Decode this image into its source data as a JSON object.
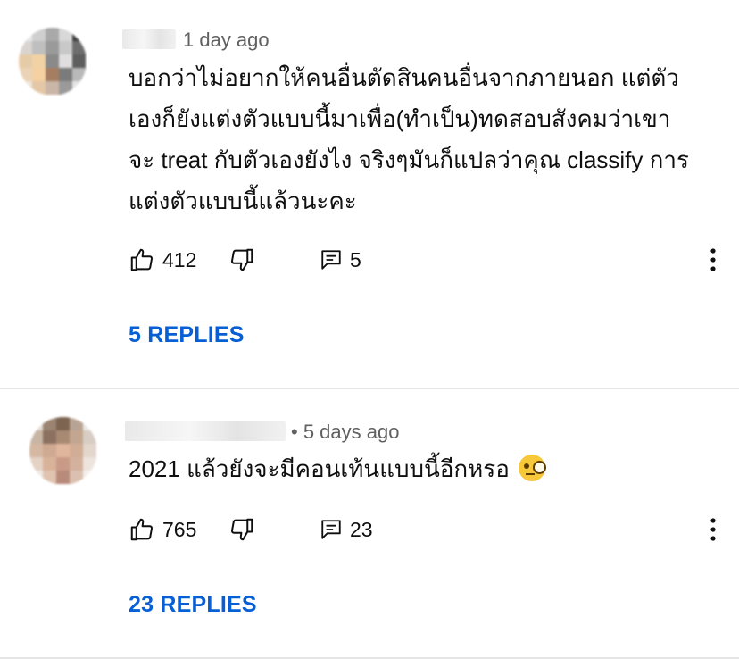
{
  "comments": [
    {
      "time": "1 day ago",
      "text_lines": [
        "บอกว่าไม่อยากให้คนอื่นตัดสินคนอื่นจากภายนอก แต่ตัว",
        "เองก็ยังแต่งตัวแบบนี้มาเพื่อ(ทำเป็น)ทดสอบสังคมว่าเขา",
        "จะ treat กับตัวเองยังไง จริงๆมันก็แปลว่าคุณ classify การ",
        "แต่งตัวแบบนี้แล้วนะคะ"
      ],
      "likes": "412",
      "reply_count": "5",
      "replies_label": "5 REPLIES"
    },
    {
      "time": "• 5 days ago",
      "text_lines": [
        "2021 แล้วยังจะมีคอนเท้นแบบนี้อีกหรอ"
      ],
      "emoji": "face-with-monocle",
      "likes": "765",
      "reply_count": "23",
      "replies_label": "23 REPLIES"
    }
  ],
  "icons": {
    "like": "thumbs-up-icon",
    "dislike": "thumbs-down-icon",
    "reply": "comment-icon",
    "more": "more-vertical-icon"
  },
  "colors": {
    "link": "#065fd4",
    "meta": "#606060",
    "text": "#0f0f0f",
    "divider": "#e5e5e5"
  }
}
